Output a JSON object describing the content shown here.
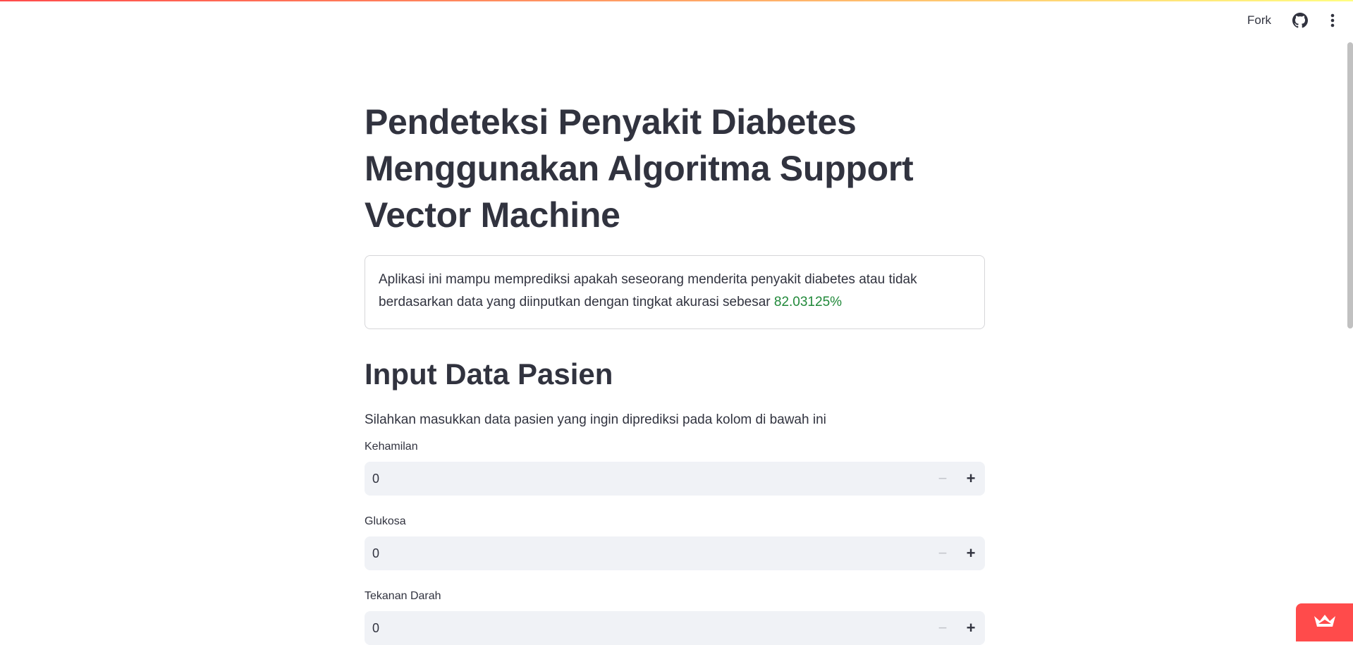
{
  "header": {
    "fork_label": "Fork",
    "icons": [
      "github-icon",
      "more-vertical-icon"
    ],
    "decoration_colors": [
      "#ff4b4b",
      "#fffd80"
    ]
  },
  "main": {
    "title": "Pendeteksi Penyakit Diabetes Menggunakan Algoritma Support Vector Machine",
    "info": {
      "text": "Aplikasi ini mampu memprediksi apakah seseorang menderita penyakit diabetes atau tidak berdasarkan data yang diinputkan dengan tingkat akurasi sebesar ",
      "accuracy": "82.03125%",
      "accuracy_color": "#21893a"
    },
    "subtitle": "Input Data Pasien",
    "instruction": "Silahkan masukkan data pasien yang ingin diprediksi pada kolom di bawah ini",
    "fields": [
      {
        "label": "Kehamilan",
        "value": "0"
      },
      {
        "label": "Glukosa",
        "value": "0"
      },
      {
        "label": "Tekanan Darah",
        "value": "0"
      }
    ]
  },
  "badge": {
    "icon": "streamlit-crown-icon",
    "color": "#ff4b4b"
  }
}
